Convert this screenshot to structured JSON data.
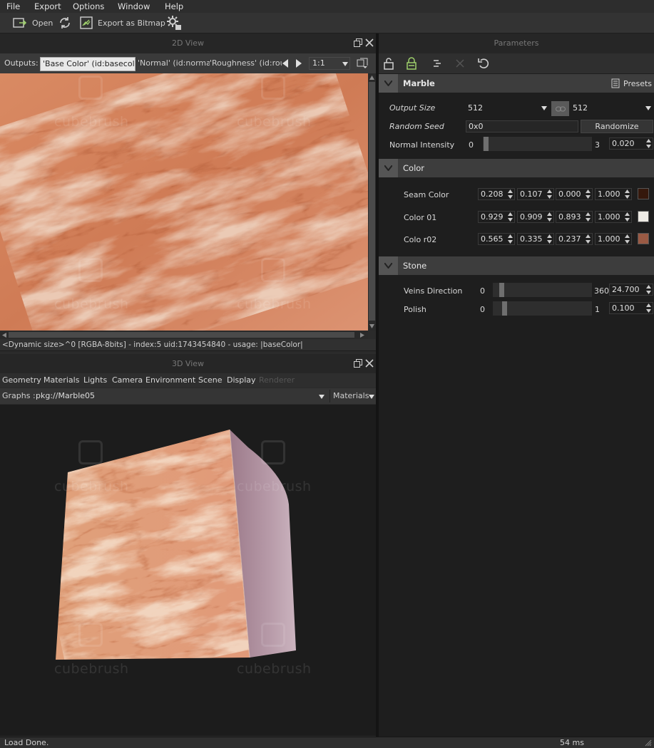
{
  "menu": [
    "File",
    "Export",
    "Options",
    "Window",
    "Help"
  ],
  "toolbar": {
    "open_label": "Open",
    "export_label": "Export as Bitmap"
  },
  "view2d": {
    "title": "2D View",
    "outputs_label": "Outputs:",
    "tabs": [
      "'Base Color' (id:basecolor)",
      "'Normal' (id:normal)",
      "'Roughness' (id:rou"
    ],
    "zoom": "1:1",
    "status": "<Dynamic size>^0 [RGBA-8bits] - index:5 uid:1743454840 - usage: |baseColor|"
  },
  "view3d": {
    "title": "3D View",
    "tabs": [
      "Geometry",
      "Materials",
      "Lights",
      "Camera",
      "Environment",
      "Scene",
      "Display",
      "Renderer"
    ],
    "graphs_label": "Graphs :",
    "graph_value": "pkg://Marble05",
    "materials_label": "Materials"
  },
  "params": {
    "title": "Parameters",
    "marble": {
      "title": "Marble",
      "presets": "Presets",
      "output_size_label": "Output Size",
      "output_size_w": "512",
      "output_size_h": "512",
      "random_seed_label": "Random Seed",
      "random_seed_value": "0x0",
      "randomize": "Randomize",
      "normal_intensity": {
        "label": "Normal Intensity",
        "min": "0",
        "max": "3",
        "value": "0.020",
        "level": 0.007
      }
    },
    "color": {
      "title": "Color",
      "rows": [
        {
          "label": "Seam Color",
          "r": "0.208",
          "g": "0.107",
          "b": "0.000",
          "a": "1.000",
          "swatch": "#35180c"
        },
        {
          "label": "Color 01",
          "r": "0.929",
          "g": "0.909",
          "b": "0.893",
          "a": "1.000",
          "swatch": "#edeae4"
        },
        {
          "label": "Colo r02",
          "r": "0.565",
          "g": "0.335",
          "b": "0.237",
          "a": "1.000",
          "swatch": "#9a5a44"
        }
      ]
    },
    "stone": {
      "title": "Stone",
      "veins": {
        "label": "Veins Direction",
        "min": "0",
        "max": "360",
        "value": "24.700",
        "level": 0.069
      },
      "polish": {
        "label": "Polish",
        "min": "0",
        "max": "1",
        "value": "0.100",
        "level": 0.1
      }
    }
  },
  "status": {
    "left": "Load Done.",
    "right": "54 ms"
  },
  "watermark": "cubebrush"
}
